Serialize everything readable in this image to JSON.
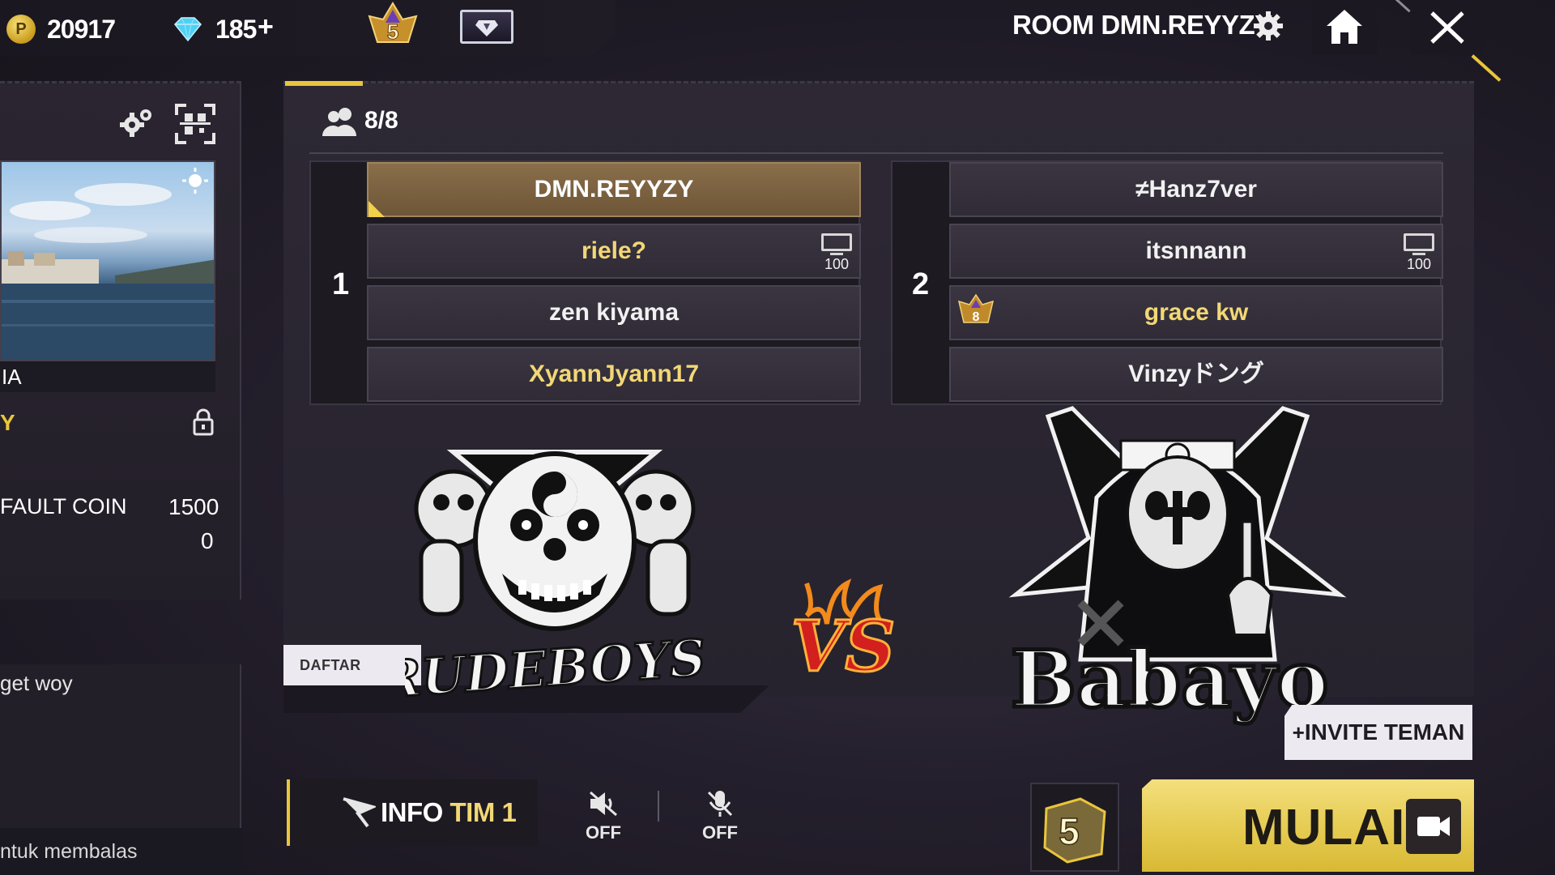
{
  "currency": {
    "coins": "20917",
    "diamonds": "185",
    "plus": "+",
    "coin_symbol": "P"
  },
  "rank_level": "5",
  "room": {
    "title": "ROOM DMN.REYYZY"
  },
  "left_panel": {
    "map_name": "IA",
    "mode_letter": "Y",
    "coin_label": "FAULT COIN",
    "coin_value": "1500",
    "extra_value": "0",
    "chat_message": "get woy",
    "chat_prompt": "ntuk membalas"
  },
  "main": {
    "player_count": "8/8",
    "team1": {
      "number": "1",
      "players": [
        {
          "name": "DMN.REYYZY"
        },
        {
          "name": "riele?",
          "badge_value": "100"
        },
        {
          "name": "zen    kiyama"
        },
        {
          "name": "XyannJyann17"
        }
      ]
    },
    "team2": {
      "number": "2",
      "players": [
        {
          "name": "≠Hanz7ver"
        },
        {
          "name": "itsnnann",
          "badge_value": "100"
        },
        {
          "name": "grace kw",
          "rank_value": "8"
        },
        {
          "name": "Vinzyドング"
        }
      ]
    },
    "spectator_label": "DAFTAR PENONTON",
    "invite_label": "INVITE TEMAN",
    "team1_logo_text": "RUDEBOYS!",
    "team2_logo_text": "Babayo",
    "vs_text": "VS"
  },
  "bottom": {
    "info_label_a": "INFO",
    "info_label_b": "TIM 1",
    "speaker_state": "OFF",
    "mic_state": "OFF",
    "dice_value": "5",
    "start_label": "MULAI"
  },
  "colors": {
    "accent_gold": "#e9c53c",
    "host_slot": "#7a6141",
    "name_gold": "#f2d776"
  }
}
